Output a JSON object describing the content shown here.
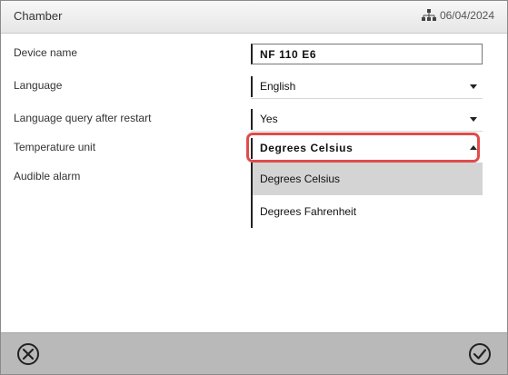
{
  "header": {
    "title": "Chamber",
    "right_text": "06/04/2024",
    "right_icon": "sitemap-icon"
  },
  "rows": [
    {
      "label": "Device name",
      "value": "NF 110 E6",
      "type": "text"
    },
    {
      "label": "Language",
      "value": "English",
      "type": "select"
    },
    {
      "label": "Language query after restart",
      "value": "Yes",
      "type": "select"
    },
    {
      "label": "Temperature unit",
      "value": "Degrees Celsius",
      "type": "select-open"
    },
    {
      "label": "Audible alarm",
      "value": "",
      "type": "none"
    }
  ],
  "dropdown": {
    "options": [
      "Degrees Celsius",
      "Degrees Fahrenheit"
    ],
    "selected_index": 0
  },
  "footer": {
    "cancel_icon": "close-circle-icon",
    "confirm_icon": "check-circle-icon"
  },
  "colors": {
    "highlight": "#e14b4b",
    "footer_bg": "#b9b9b9",
    "selected_bg": "#d4d4d4"
  }
}
